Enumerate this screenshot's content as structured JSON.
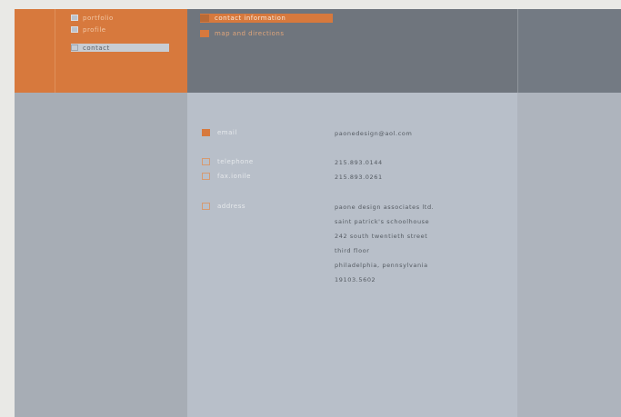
{
  "nav": {
    "items": [
      {
        "label": "portfolio"
      },
      {
        "label": "profile"
      },
      {
        "label": "contact"
      }
    ]
  },
  "tabs": [
    {
      "label": "contact information"
    },
    {
      "label": "map and directions"
    }
  ],
  "contact": {
    "email_label": "email",
    "email": "paonedesign@aol.com",
    "telephone_label": "telephone",
    "telephone": "215.893.0144",
    "fax_label": "fax.ionile",
    "fax": "215.893.0261",
    "address_label": "address",
    "address_lines": [
      "paone design associates ltd.",
      "saint patrick's schoolhouse",
      "242 south twentieth street",
      "third floor",
      "philadelphia, pennsylvania",
      "19103.5602"
    ]
  },
  "colors": {
    "accent": "#d7793d",
    "dark_gray": "#6f757d",
    "light_gray": "#b8bfc9"
  }
}
